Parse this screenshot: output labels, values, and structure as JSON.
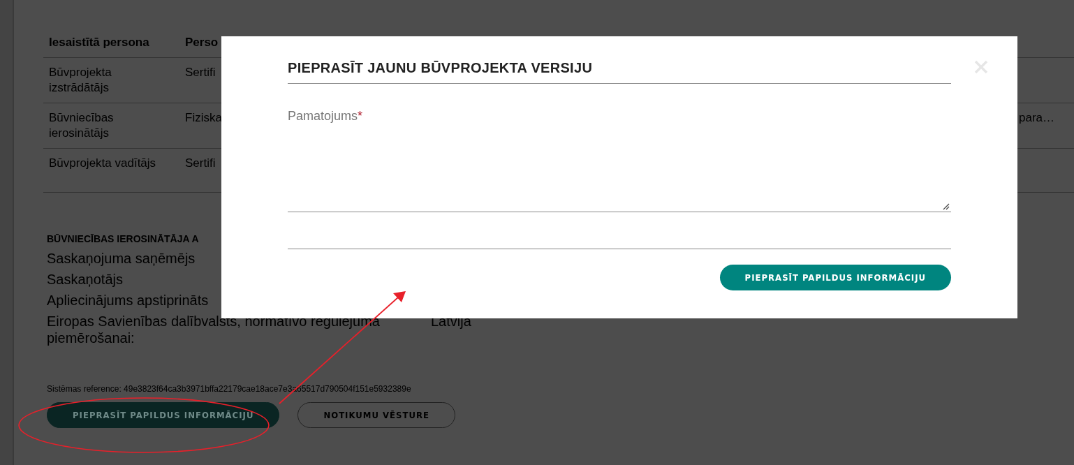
{
  "table": {
    "columns": [
      "Iesaistītā persona",
      "Perso"
    ],
    "rows": [
      {
        "cells": [
          "Būvprojekta izstrādātājs",
          "Sertifi"
        ]
      },
      {
        "cells": [
          "Būvniecības ierosinātājs",
          "Fiziska",
          "para…"
        ]
      },
      {
        "cells": [
          "Būvprojekta vadītājs",
          "Sertifi"
        ]
      }
    ]
  },
  "section": {
    "title": "BŪVNIECĪBAS IEROSINĀTĀJA A",
    "fields": [
      {
        "label": "Saskaņojuma saņēmējs"
      },
      {
        "label": "Saskaņotājs"
      },
      {
        "label": "Apliecinājums apstiprināts"
      },
      {
        "label": "Eiropas Savienības dalībvalsts, normatīvo regulējuma piemērošanai:",
        "value": "Latvija"
      }
    ]
  },
  "reference": "Sistēmas reference: 49e3823f64ca3b3971bffa22179cae18ace7e3a65517d790504f151e5932389e",
  "buttons": [
    {
      "label": "PIEPRASĪT PAPILDUS INFORMĀCIJU",
      "kind": "primary"
    },
    {
      "label": "NOTIKUMU VĒSTURE",
      "kind": "outline"
    }
  ],
  "modal": {
    "title": "PIEPRASĪT JAUNU BŪVPROJEKTA VERSIJU",
    "field": {
      "label": "Pamatojums",
      "required_mark": "*"
    },
    "button": "PIEPRASĪT PAPILDUS INFORMĀCIJU"
  }
}
